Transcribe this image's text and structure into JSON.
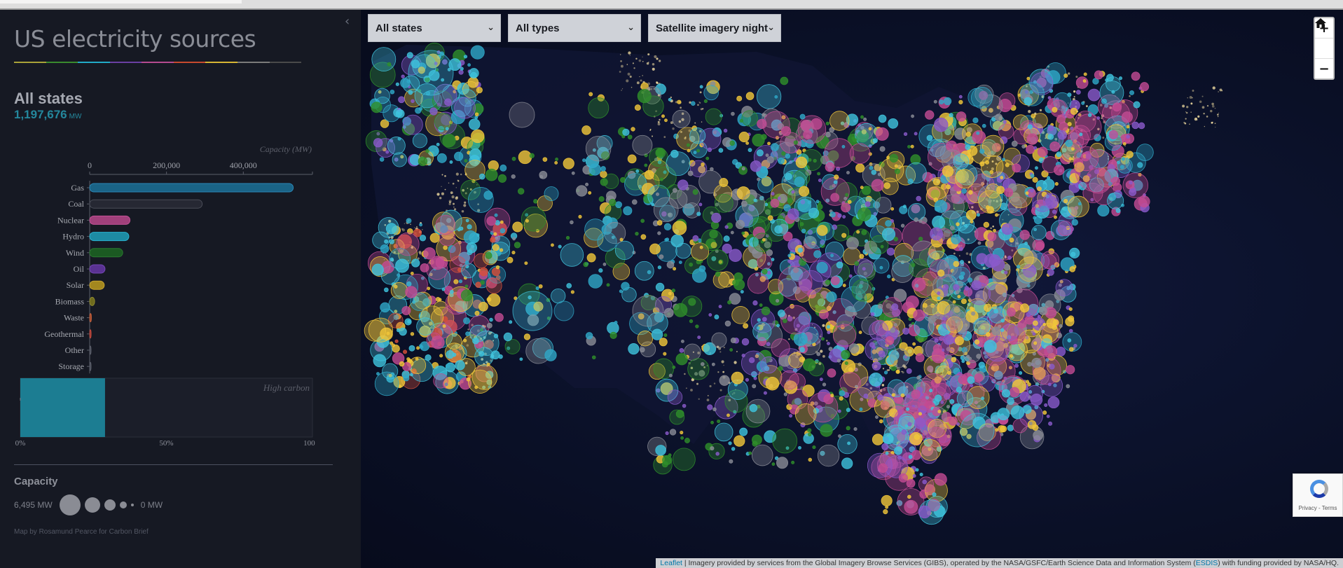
{
  "sidebar": {
    "title": "US electricity sources",
    "title_rule_colors": [
      "#a9a238",
      "#3a8a2e",
      "#22aac7",
      "#6a3fa3",
      "#b54b8f",
      "#c64a2e",
      "#d6b534",
      "#7a7a7a",
      "#4a4a4a"
    ],
    "state_name": "All states",
    "total_value": "1,197,676",
    "total_unit": "MW",
    "collapse_icon": "chevron-left-icon"
  },
  "chart_data": [
    {
      "type": "bar",
      "orientation": "horizontal",
      "axis_title": "Capacity (MW)",
      "categories": [
        "Gas",
        "Coal",
        "Nuclear",
        "Hydro",
        "Wind",
        "Oil",
        "Solar",
        "Biomass",
        "Waste",
        "Geothermal",
        "Other",
        "Storage"
      ],
      "values": [
        530000,
        293000,
        105000,
        102000,
        86000,
        40000,
        38000,
        13000,
        4500,
        3800,
        2500,
        1000
      ],
      "colors": [
        "#1a6386",
        "#262833",
        "#a0407b",
        "#1d8ba3",
        "#1b5a22",
        "#5a3293",
        "#a3871f",
        "#6f6b1e",
        "#a14a2e",
        "#a13b32",
        "#4a4d58",
        "#4a4d58"
      ],
      "outline_colors": [
        "#2a86b5",
        "#4a4d58",
        "#c25196",
        "#2ab2cf",
        "#2a7a30",
        "#7446b5",
        "#caa630",
        "#8e8a2e",
        "#c2603c",
        "#c04a3e",
        "#5a5e6a",
        "#5a5e6a"
      ],
      "xticks": [
        0,
        200000,
        400000
      ],
      "xtick_labels": [
        "0",
        "200,000",
        "400,000"
      ],
      "xlim": [
        0,
        580000
      ]
    },
    {
      "type": "bar",
      "orientation": "horizontal",
      "label": "High carbon",
      "value_percent": 29,
      "xticks": [
        "0%",
        "50%",
        "100%"
      ],
      "bar_color": "#1c7d92"
    }
  ],
  "legend": {
    "title": "Capacity",
    "max_label": "6,495 MW",
    "min_label": "0 MW",
    "dot_radii": [
      15,
      11,
      8,
      5,
      2
    ]
  },
  "credit": "Map by Rosamund Pearce for Carbon Brief",
  "map": {
    "filters": {
      "state": "All states",
      "type": "All types",
      "basemap": "Satellite imagery night"
    },
    "filter_chevron_icon": "chevron-down-icon",
    "zoom_in": "+",
    "home_icon": "home-icon",
    "zoom_out": "−",
    "recaptcha_text": "Privacy - Terms",
    "attribution": {
      "leaflet": "Leaflet",
      "text1": " | Imagery provided by services from the Global Imagery Browse Services (GIBS), operated by the NASA/GSFC/Earth Science Data and Information System (",
      "esdis": "ESDIS",
      "text2": ") with funding provided by NASA/HQ."
    },
    "source_colors": {
      "gas": "#3fc3dd",
      "coal": "#8a8c96",
      "nuclear": "#c34b93",
      "hydro": "#2fa8c8",
      "wind": "#2f8f2a",
      "oil": "#8a5acb",
      "solar": "#f1c73a",
      "biomass": "#9a9a3a",
      "geothermal": "#d8503a"
    }
  }
}
